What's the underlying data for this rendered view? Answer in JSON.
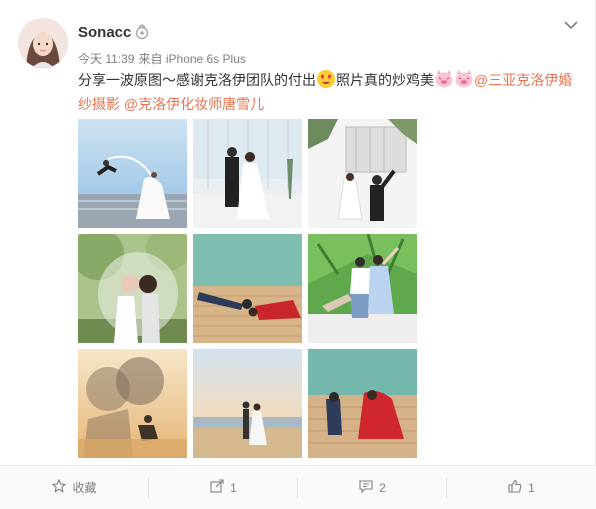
{
  "post": {
    "username": "Sonacc",
    "time": "今天 11:39",
    "via_prefix": "来自",
    "device": "iPhone 6s Plus",
    "text_part1": "分享一波原图～感谢克洛伊团队的付出",
    "text_part2": "照片真的炒鸡美",
    "mention1_line1": "@三亚克洛伊婚",
    "mention1_line2": "纱摄影",
    "mention2": "@克洛伊化妆师唐雪儿",
    "icons": [
      "heart-eyes-emoji",
      "pig-face-emoji"
    ]
  },
  "photos": [
    {
      "name": "photo-couple-jumping-sky"
    },
    {
      "name": "photo-couple-glass-house"
    },
    {
      "name": "photo-couple-white-house"
    },
    {
      "name": "photo-couple-garden-veil"
    },
    {
      "name": "photo-couple-lying-deck"
    },
    {
      "name": "photo-couple-palm-trees"
    },
    {
      "name": "photo-couple-silhouette-kiss"
    },
    {
      "name": "photo-couple-beach-sunset"
    },
    {
      "name": "photo-couple-red-dress-deck"
    }
  ],
  "actions": {
    "favorite_label": "收藏",
    "repost_count": "1",
    "comment_count": "2",
    "like_count": "1"
  },
  "colors": {
    "mention": "#eb7350",
    "meta": "#808080"
  }
}
